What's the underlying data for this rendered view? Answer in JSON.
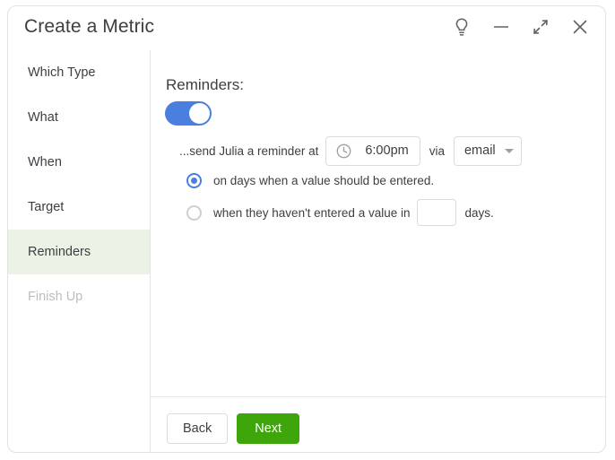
{
  "window": {
    "title": "Create a Metric",
    "controls": [
      {
        "name": "help-lightbulb-icon",
        "label": "Help"
      },
      {
        "name": "minimize-icon",
        "label": "Minimize"
      },
      {
        "name": "restore-icon",
        "label": "Restore"
      },
      {
        "name": "close-icon",
        "label": "Close"
      }
    ]
  },
  "sidebar": {
    "items": [
      {
        "label": "Which Type",
        "state": "normal"
      },
      {
        "label": "What",
        "state": "normal"
      },
      {
        "label": "When",
        "state": "normal"
      },
      {
        "label": "Target",
        "state": "normal"
      },
      {
        "label": "Reminders",
        "state": "active"
      },
      {
        "label": "Finish Up",
        "state": "disabled"
      }
    ]
  },
  "main": {
    "section_title": "Reminders:",
    "toggle": {
      "name": "reminders-toggle",
      "state": "on"
    },
    "reminder_row": {
      "prefix_text": "...send Julia a reminder at",
      "time_icon": "clock-icon",
      "time_value": "6:00pm",
      "via_text": "via",
      "channel_value": "email",
      "channel_caret": "chevron-down-icon"
    },
    "options": [
      {
        "label": "on days when a value should be entered.",
        "selected": true
      },
      {
        "label": "when they haven't entered a value in",
        "selected": false,
        "days_value": "",
        "days_placeholder": "",
        "suffix": "days."
      }
    ]
  },
  "footer": {
    "back_label": "Back",
    "next_label": "Next"
  },
  "colors": {
    "accent_blue": "#4a7fe0",
    "next_green": "#3ea60b",
    "active_nav_bg": "#eaf3e5",
    "text": "#3c4043",
    "muted_text": "#bdbdbd",
    "border": "#dcdcdc"
  }
}
